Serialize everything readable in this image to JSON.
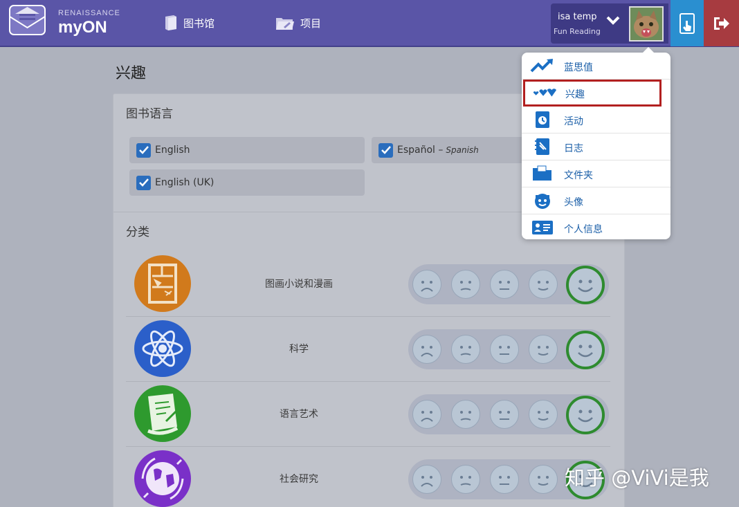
{
  "brand": {
    "small": "RENAISSANCE",
    "name": "myON"
  },
  "nav": {
    "library": "图书馆",
    "projects": "项目"
  },
  "user": {
    "name": "isa temp",
    "class": "Fun Reading"
  },
  "page": {
    "title": "兴趣"
  },
  "languages": {
    "title": "图书语言",
    "items": [
      {
        "label": "English",
        "sub": "",
        "checked": true
      },
      {
        "label": "Español – ",
        "sub": "Spanish",
        "checked": true
      },
      {
        "label": "English (UK)",
        "sub": "",
        "checked": true
      }
    ]
  },
  "categories": {
    "title": "分类",
    "items": [
      {
        "label": "图画小说和漫画",
        "icon": "graphic-novel-icon",
        "color": "#d17a1c",
        "rating": 5
      },
      {
        "label": "科学",
        "icon": "atom-icon",
        "color": "#2b5fc9",
        "rating": 5
      },
      {
        "label": "语言艺术",
        "icon": "scroll-icon",
        "color": "#2e9a2e",
        "rating": 5
      },
      {
        "label": "社会研究",
        "icon": "globe-icon",
        "color": "#7a30c8",
        "rating": 5
      }
    ]
  },
  "menu": {
    "items": [
      {
        "label": "蓝思值",
        "icon": "trend-chart-icon"
      },
      {
        "label": "兴趣",
        "icon": "hearts-icon",
        "active": true
      },
      {
        "label": "活动",
        "icon": "activity-clock-icon"
      },
      {
        "label": "日志",
        "icon": "journal-icon"
      },
      {
        "label": "文件夹",
        "icon": "folder-icon"
      },
      {
        "label": "头像",
        "icon": "avatar-face-icon"
      },
      {
        "label": "个人信息",
        "icon": "profile-card-icon"
      }
    ]
  },
  "watermark": "知乎 @ViVi是我",
  "colors": {
    "topbar": "#5a55a7",
    "menu_text": "#1b5fa8",
    "highlight": "#b21f1f",
    "selected_face": "#2e8b2f"
  }
}
